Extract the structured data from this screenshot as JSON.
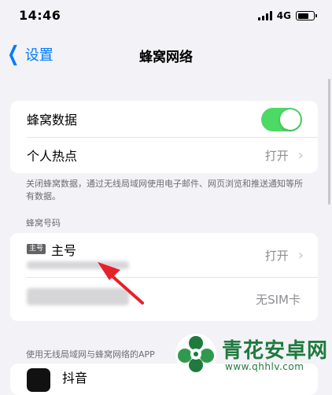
{
  "status_bar": {
    "time": "14:46",
    "network": "4G"
  },
  "nav": {
    "back_label": "设置",
    "title": "蜂窝网络"
  },
  "cellular_group": {
    "cellular_data_label": "蜂窝数据",
    "cellular_data_on": true,
    "hotspot_label": "个人热点",
    "hotspot_value": "打开"
  },
  "footnote": "关闭蜂窝数据，通过无线局域网使用电子邮件、网页浏览和推送通知等所有数据。",
  "sim_section": {
    "header": "蜂窝号码",
    "primary_badge": "主号",
    "primary_name": "主号",
    "primary_value": "打开",
    "secondary_value": "无SIM卡"
  },
  "apps_section": {
    "header": "使用无线局域网与蜂窝网络的APP",
    "first_app_name": "抖音"
  },
  "watermark": {
    "name": "青花安卓网",
    "url": "www.qhhlv.com"
  },
  "colors": {
    "accent": "#007aff",
    "toggle_on": "#4cd964",
    "arrow": "#e8202a",
    "watermark": "#1f7a3d"
  }
}
